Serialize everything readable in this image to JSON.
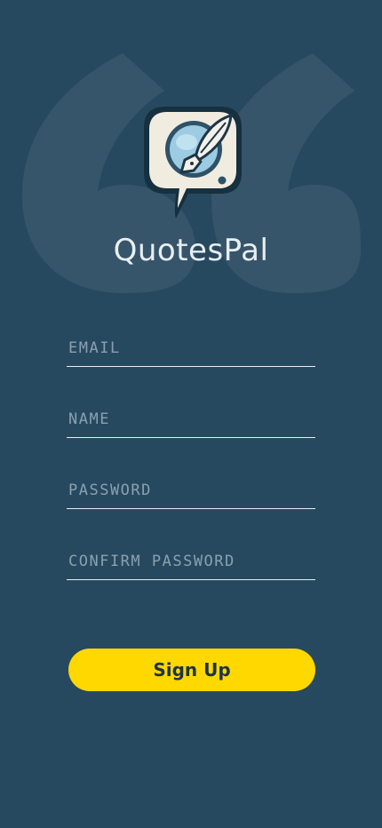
{
  "app": {
    "name": "QuotesPal",
    "logo_icon": "quill-speech-bubble-icon",
    "background_icon": "quotation-mark-icon"
  },
  "form": {
    "email_placeholder": "EMAIL",
    "email_value": "",
    "name_placeholder": "NAME",
    "name_value": "",
    "password_placeholder": "PASSWORD",
    "password_value": "",
    "confirm_password_placeholder": "CONFIRM PASSWORD",
    "confirm_password_value": ""
  },
  "actions": {
    "signup_label": "Sign Up"
  },
  "colors": {
    "background": "#27495f",
    "accent": "#ffd800",
    "field_text": "#8aa0b1",
    "underline": "#e8edf1"
  }
}
